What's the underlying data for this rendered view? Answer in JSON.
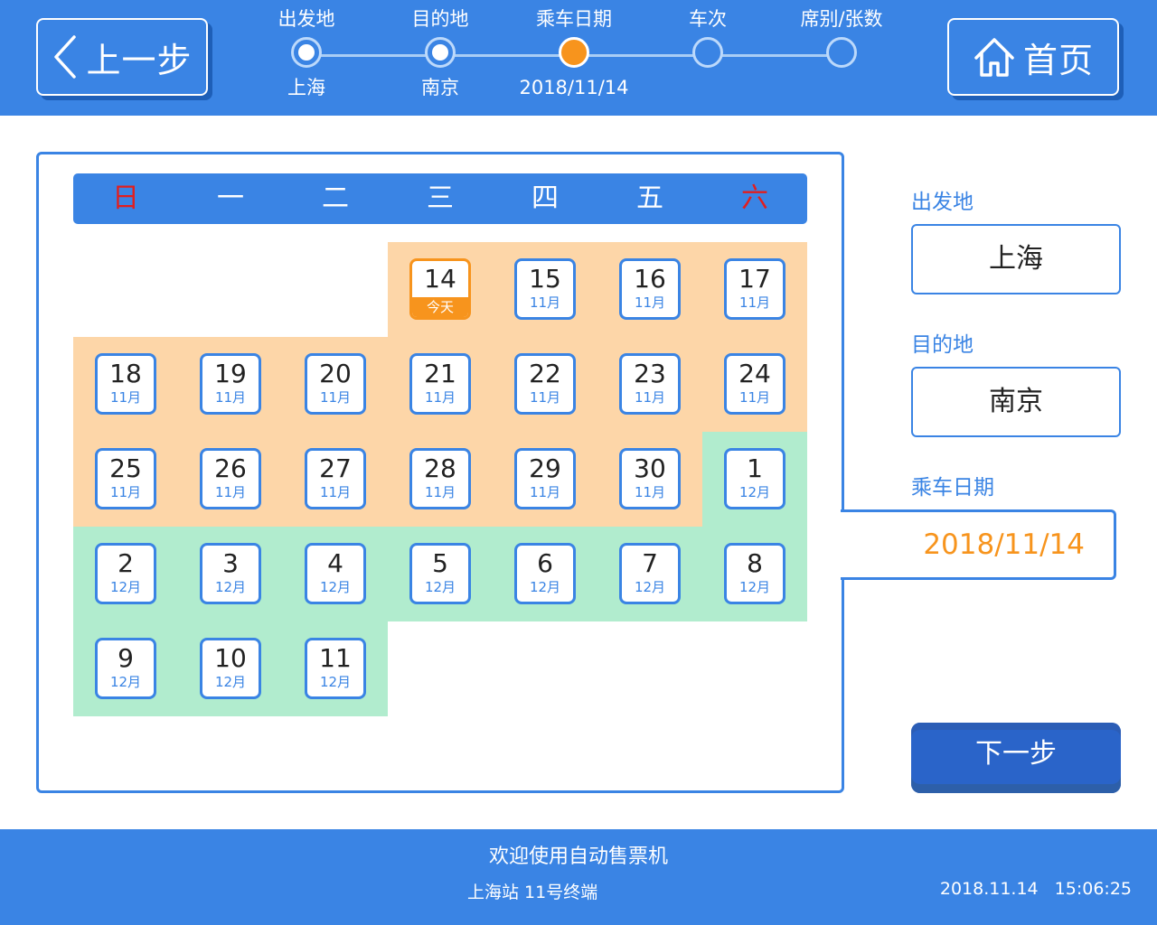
{
  "nav": {
    "back_label": "上一步",
    "home_label": "首页",
    "back_icon": "chevron-left-icon",
    "home_icon": "home-icon"
  },
  "steps": [
    {
      "name": "出发地",
      "value": "上海",
      "state": "done"
    },
    {
      "name": "目的地",
      "value": "南京",
      "state": "done"
    },
    {
      "name": "乘车日期",
      "value": "2018/11/14",
      "state": "active"
    },
    {
      "name": "车次",
      "value": "",
      "state": "pending"
    },
    {
      "name": "席别/张数",
      "value": "",
      "state": "pending"
    }
  ],
  "calendar": {
    "weekdays": [
      "日",
      "一",
      "二",
      "三",
      "四",
      "五",
      "六"
    ],
    "today_label": "今天",
    "nov_color": "#fdd6a8",
    "dec_color": "#b1ecce",
    "weekend_color": "#e21e1e",
    "days": [
      {
        "d": "14",
        "m": "今天",
        "today": true
      },
      {
        "d": "15",
        "m": "11月"
      },
      {
        "d": "16",
        "m": "11月"
      },
      {
        "d": "17",
        "m": "11月"
      },
      {
        "d": "18",
        "m": "11月"
      },
      {
        "d": "19",
        "m": "11月"
      },
      {
        "d": "20",
        "m": "11月"
      },
      {
        "d": "21",
        "m": "11月"
      },
      {
        "d": "22",
        "m": "11月"
      },
      {
        "d": "23",
        "m": "11月"
      },
      {
        "d": "24",
        "m": "11月"
      },
      {
        "d": "25",
        "m": "11月"
      },
      {
        "d": "26",
        "m": "11月"
      },
      {
        "d": "27",
        "m": "11月"
      },
      {
        "d": "28",
        "m": "11月"
      },
      {
        "d": "29",
        "m": "11月"
      },
      {
        "d": "30",
        "m": "11月"
      },
      {
        "d": "1",
        "m": "12月"
      },
      {
        "d": "2",
        "m": "12月"
      },
      {
        "d": "3",
        "m": "12月"
      },
      {
        "d": "4",
        "m": "12月"
      },
      {
        "d": "5",
        "m": "12月"
      },
      {
        "d": "6",
        "m": "12月"
      },
      {
        "d": "7",
        "m": "12月"
      },
      {
        "d": "8",
        "m": "12月"
      },
      {
        "d": "9",
        "m": "12月"
      },
      {
        "d": "10",
        "m": "12月"
      },
      {
        "d": "11",
        "m": "12月"
      }
    ]
  },
  "form": {
    "from_label": "出发地",
    "from_value": "上海",
    "to_label": "目的地",
    "to_value": "南京",
    "date_label": "乘车日期",
    "date_value": "2018/11/14",
    "next_label": "下一步"
  },
  "footer": {
    "welcome": "欢迎使用自动售票机",
    "terminal": "上海站 11号终端",
    "date": "2018.11.14",
    "time": "15:06:25"
  },
  "colors": {
    "primary": "#3a84e4",
    "accent": "#f7941d"
  }
}
